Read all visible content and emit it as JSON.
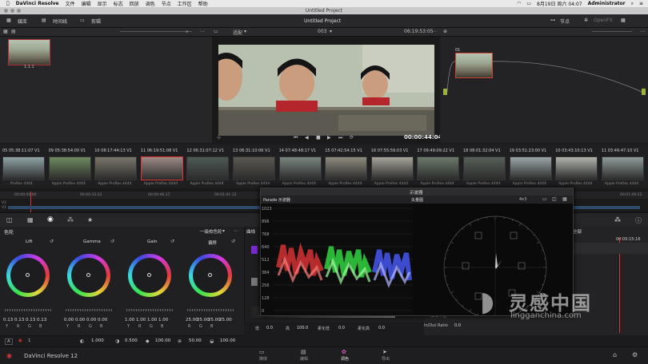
{
  "menubar": {
    "apple": "",
    "app": "DaVinci Resolve",
    "items": [
      "文件",
      "编辑",
      "显示",
      "标志",
      "回放",
      "调色",
      "节点",
      "工作区",
      "帮助"
    ],
    "date": "8月19日 周六 04:07",
    "user": "Administrator"
  },
  "window": {
    "title": "Untitled Project"
  },
  "toolbar": {
    "media_pool": "媒库",
    "timelines": "时间线",
    "clips": "剪辑",
    "project": "Untitled Project",
    "nodes": "节点",
    "openfx": "OpenFX",
    "lightbox": "剪辑"
  },
  "gallery": {
    "still_label": "1.1.1"
  },
  "viewer": {
    "zoom": "适配",
    "clip_number": "003",
    "source_timecode": "06:19:53:05",
    "playhead_timecode": "00:00:44:04"
  },
  "node_editor": {
    "node_label": "01"
  },
  "clips": [
    {
      "num": "05",
      "tc": "05:38:11:07",
      "track": "V1",
      "codec": "... ProRes 4444"
    },
    {
      "num": "09",
      "tc": "05:38:54:00",
      "track": "V1",
      "codec": "Apple ProRes 4444"
    },
    {
      "num": "10",
      "tc": "08:17:44:13",
      "track": "V1",
      "codec": "Apple ProRes 4444"
    },
    {
      "num": "11",
      "tc": "06:19:51:08",
      "track": "V1",
      "codec": "Apple ProRes 4444"
    },
    {
      "num": "12",
      "tc": "06:31:07:12",
      "track": "V1",
      "codec": "Apple ProRes 4444"
    },
    {
      "num": "13",
      "tc": "06:31:10:06",
      "track": "V1",
      "codec": "Apple ProRes 4444"
    },
    {
      "num": "14",
      "tc": "07:48:48:17",
      "track": "V1",
      "codec": "Apple ProRes 4444"
    },
    {
      "num": "15",
      "tc": "07:42:54:15",
      "track": "V1",
      "codec": "Apple ProRes 4444"
    },
    {
      "num": "16",
      "tc": "07:55:59:03",
      "track": "V1",
      "codec": "Apple ProRes 4444"
    },
    {
      "num": "17",
      "tc": "09:49:09:22",
      "track": "V1",
      "codec": "Apple ProRes 4444"
    },
    {
      "num": "18",
      "tc": "08:01:32:04",
      "track": "V1",
      "codec": "Apple ProRes 4444"
    },
    {
      "num": "19",
      "tc": "03:51:23:00",
      "track": "V1",
      "codec": "Apple ProRes 4444"
    },
    {
      "num": "10",
      "tc": "03:43:10:13",
      "track": "V1",
      "codec": "Apple ProRes 4444"
    },
    {
      "num": "11",
      "tc": "03:49:47:10",
      "track": "V1",
      "codec": "Apple ProRes 4444"
    }
  ],
  "mini_timeline": {
    "ticks": [
      "00:00:00:00",
      "00:00:33:22",
      "00:00:46:17",
      "00:00:55:02",
      "00:01:01:12",
      "00:01:09:22"
    ],
    "tracks": [
      "V2",
      "V1"
    ]
  },
  "color_wheels": {
    "panel_title": "色轮",
    "mode": "一级校色轮",
    "wheels": [
      {
        "label": "Lift",
        "values": [
          "0.13",
          "0.13",
          "0.13",
          "0.13"
        ],
        "channels": [
          "Y",
          "R",
          "G",
          "B"
        ]
      },
      {
        "label": "Gamma",
        "values": [
          "0.00",
          "0.00",
          "0.00",
          "0.00"
        ],
        "channels": [
          "Y",
          "R",
          "G",
          "B"
        ]
      },
      {
        "label": "Gain",
        "values": [
          "1.00",
          "1.00",
          "1.00",
          "1.00"
        ],
        "channels": [
          "Y",
          "R",
          "G",
          "B"
        ]
      },
      {
        "label": "偏移",
        "values": [
          "25.00",
          "25.00",
          "25.00",
          "25.00"
        ],
        "channels": [
          "R",
          "G",
          "B",
          ""
        ]
      }
    ],
    "footer": {
      "a_label": "A",
      "page": "1",
      "contrast": "1.000",
      "pivot": "0.500",
      "sat": "100.00",
      "hue": "50.00",
      "lum_mix": "100.00"
    }
  },
  "scopes": {
    "title": "示波器",
    "parade_label": "Parade 示波器",
    "vector_label": "矢量图",
    "zoom": "4x3",
    "parade_scale": [
      "1023",
      "896",
      "768",
      "640",
      "512",
      "384",
      "256",
      "128",
      "0"
    ]
  },
  "curves": {
    "label": "曲线",
    "low": "低",
    "low_val": "0.0",
    "high": "高",
    "high_val": "100.0",
    "low_soft": "柔化低",
    "low_soft_val": "0.0",
    "high_soft": "柔化高",
    "high_soft_val": "0.0"
  },
  "keyframes": {
    "label": "全部",
    "tc": "00:00:15:16",
    "in_out_label": "In/Out Ratio",
    "in_out_val": "0.0",
    "temporal": "降噪半径",
    "temporal_val": "0.0"
  },
  "bottom": {
    "app_version": "DaVinci Resolve 12",
    "tabs": [
      "媒体",
      "编辑",
      "调色",
      "导出"
    ],
    "active_tab": "调色"
  },
  "watermark": {
    "cn": "灵感中国",
    "url": "lingganchina.com"
  }
}
